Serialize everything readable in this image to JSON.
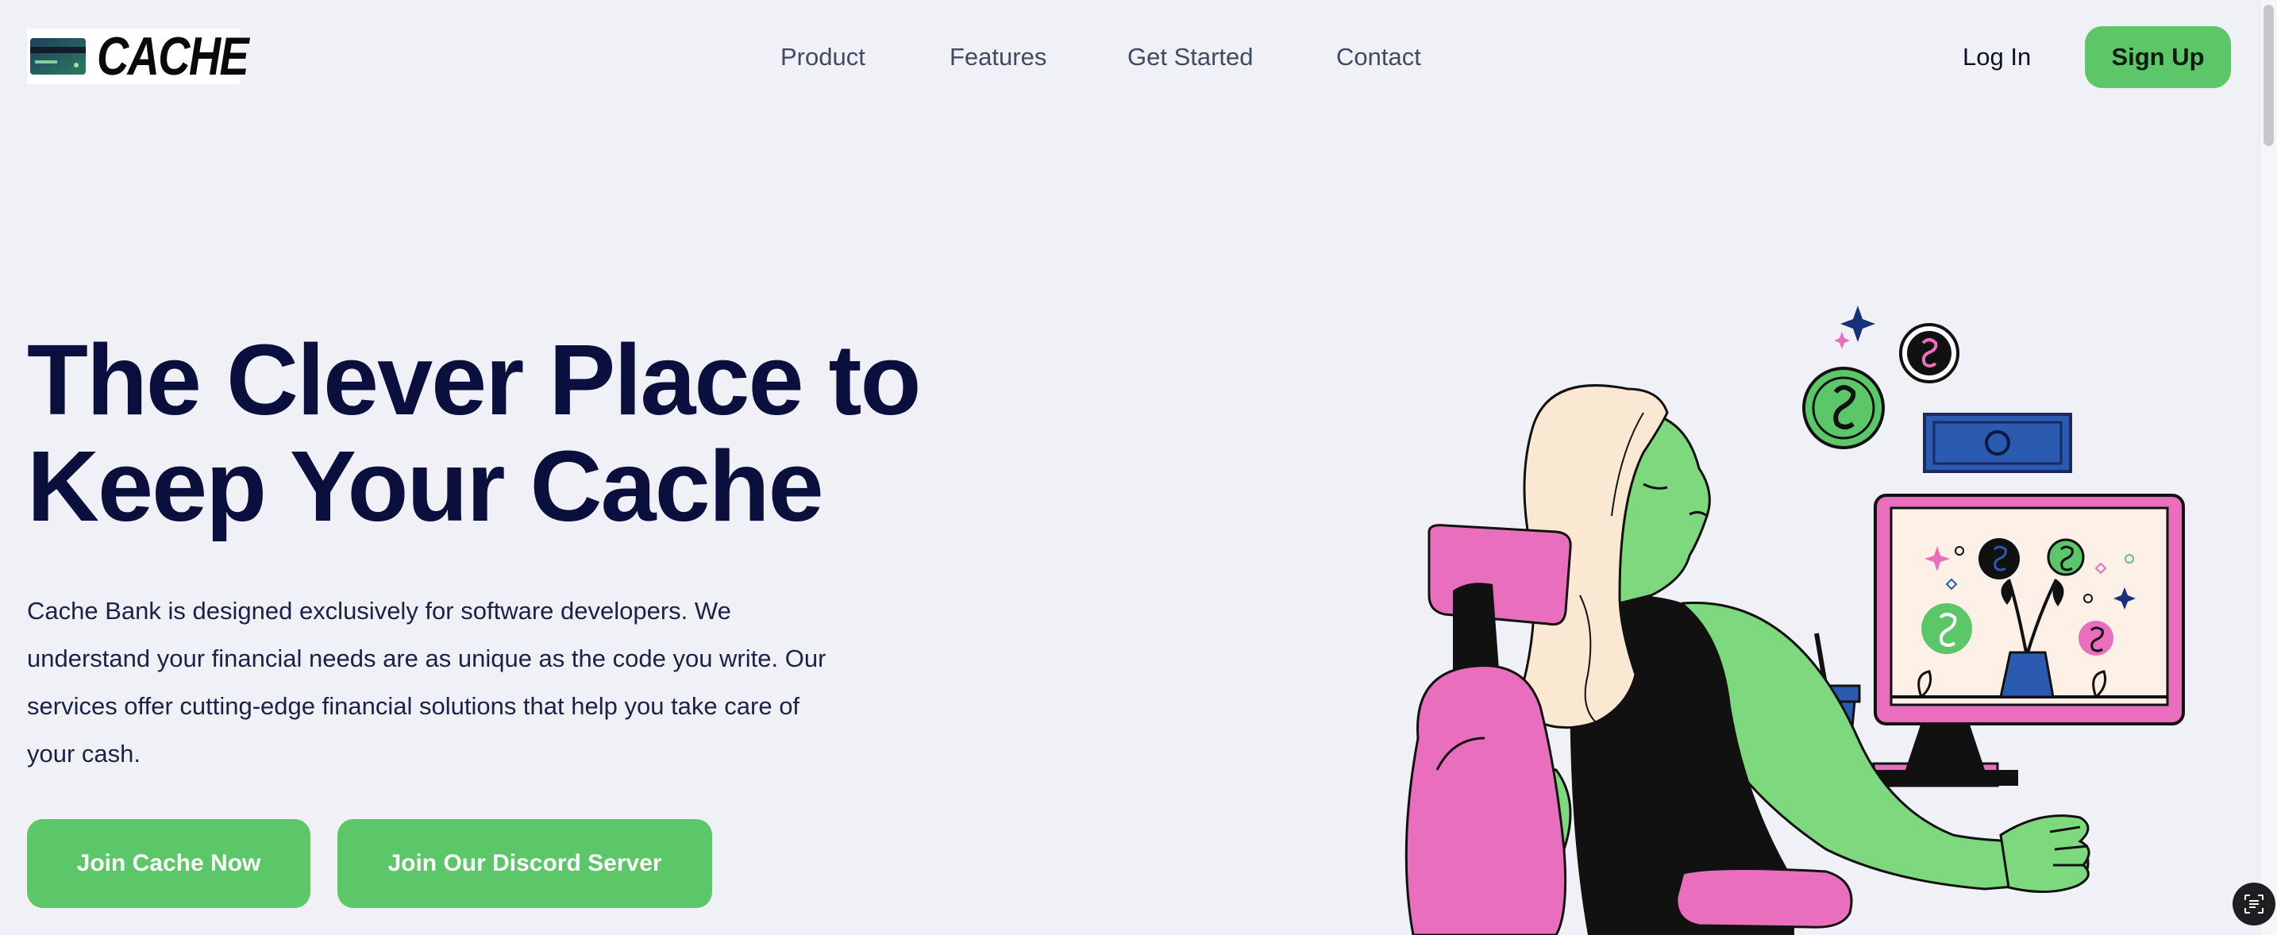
{
  "brand": {
    "logo_text": "CACHE",
    "logo_icon": "credit-card-icon"
  },
  "nav": {
    "items": [
      {
        "label": "Product"
      },
      {
        "label": "Features"
      },
      {
        "label": "Get Started"
      },
      {
        "label": "Contact"
      }
    ],
    "login_label": "Log In",
    "signup_label": "Sign Up"
  },
  "hero": {
    "title_line1": "The Clever Place to",
    "title_line2": "Keep Your Cache",
    "description": "Cache Bank is designed exclusively for software developers. We understand your financial needs are as unique as the code you write. Our services offer cutting-edge financial solutions that help you take care of your cash.",
    "cta_primary": "Join Cache Now",
    "cta_secondary": "Join Our Discord Server"
  },
  "colors": {
    "background": "#f0f1f6",
    "accent_green": "#5cc768",
    "title_navy": "#0b0f3d",
    "illustration_pink": "#e96ebd",
    "illustration_blue": "#2a5bb0"
  },
  "floating_button_icon": "text-recognition-icon"
}
